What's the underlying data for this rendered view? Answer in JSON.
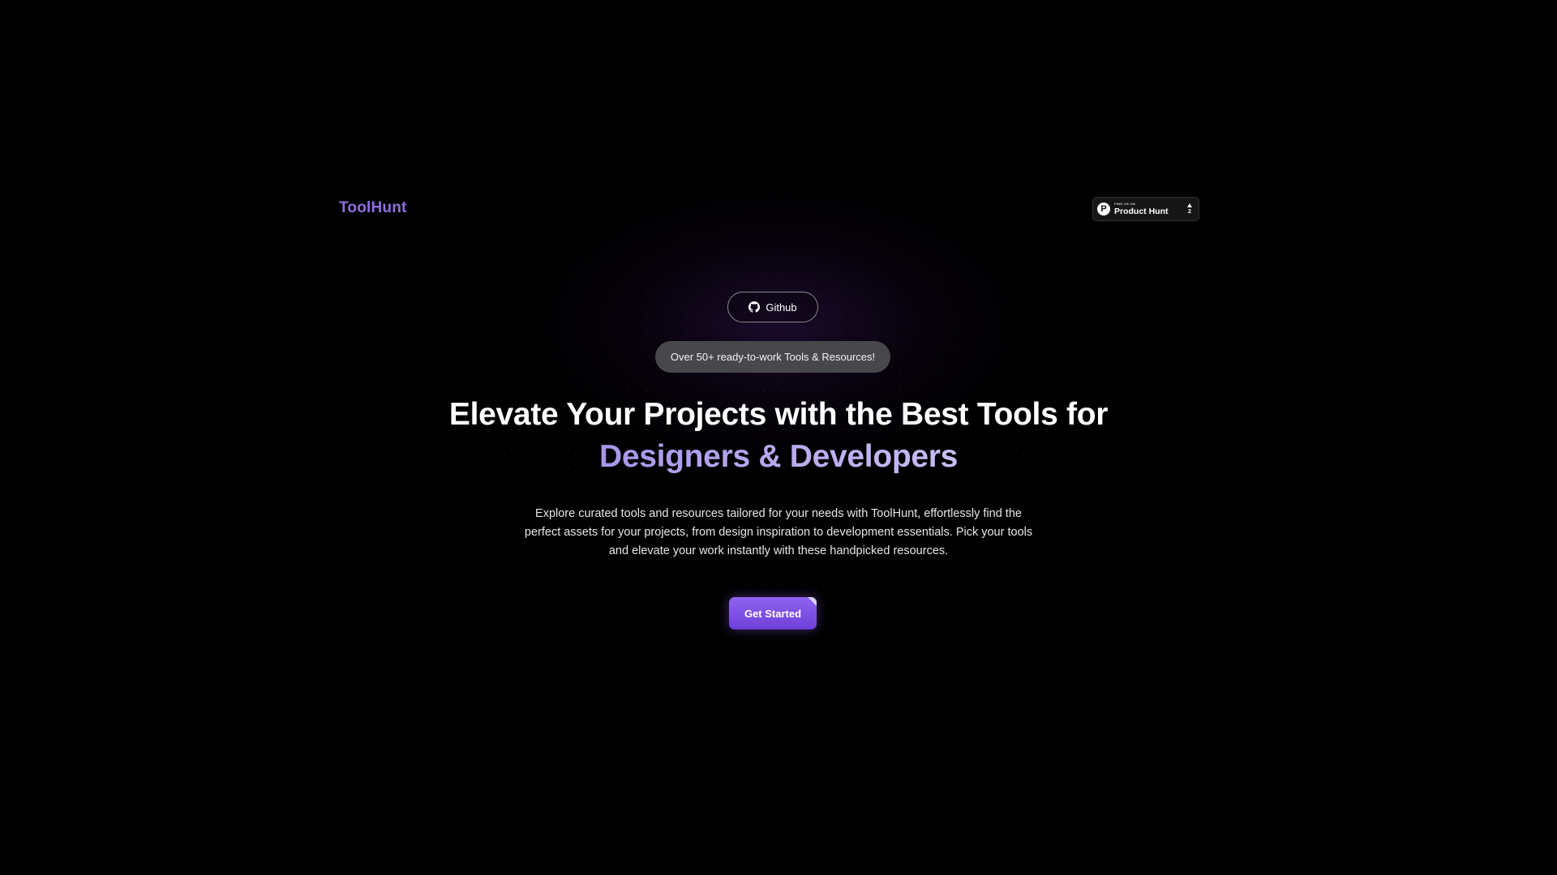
{
  "header": {
    "logo_text": "ToolHunt",
    "product_hunt_badge": {
      "small_text": "FIND US ON",
      "big_text": "Product Hunt",
      "logo_letter": "P",
      "vote_count": "2"
    }
  },
  "hero": {
    "github_button_label": "Github",
    "pill_text": "Over 50+ ready-to-work Tools & Resources!",
    "headline_line1": "Elevate Your Projects with the Best Tools for",
    "headline_line2": "Designers & Developers",
    "description": "Explore curated tools and resources tailored for your needs with ToolHunt, effortlessly find the perfect assets for your projects, from design inspiration to development essentials. Pick your tools and elevate your work instantly with these handpicked resources.",
    "cta_label": "Get Started"
  },
  "colors": {
    "background": "#000000",
    "brand": "#8f6fe0",
    "accent_text": "#b6a4ec",
    "cta": "#7c4fe6",
    "pill_bg": "#48484c"
  },
  "icons": {
    "github": "github-icon",
    "product_hunt": "product-hunt-icon",
    "upvote": "upvote-arrow-icon"
  }
}
